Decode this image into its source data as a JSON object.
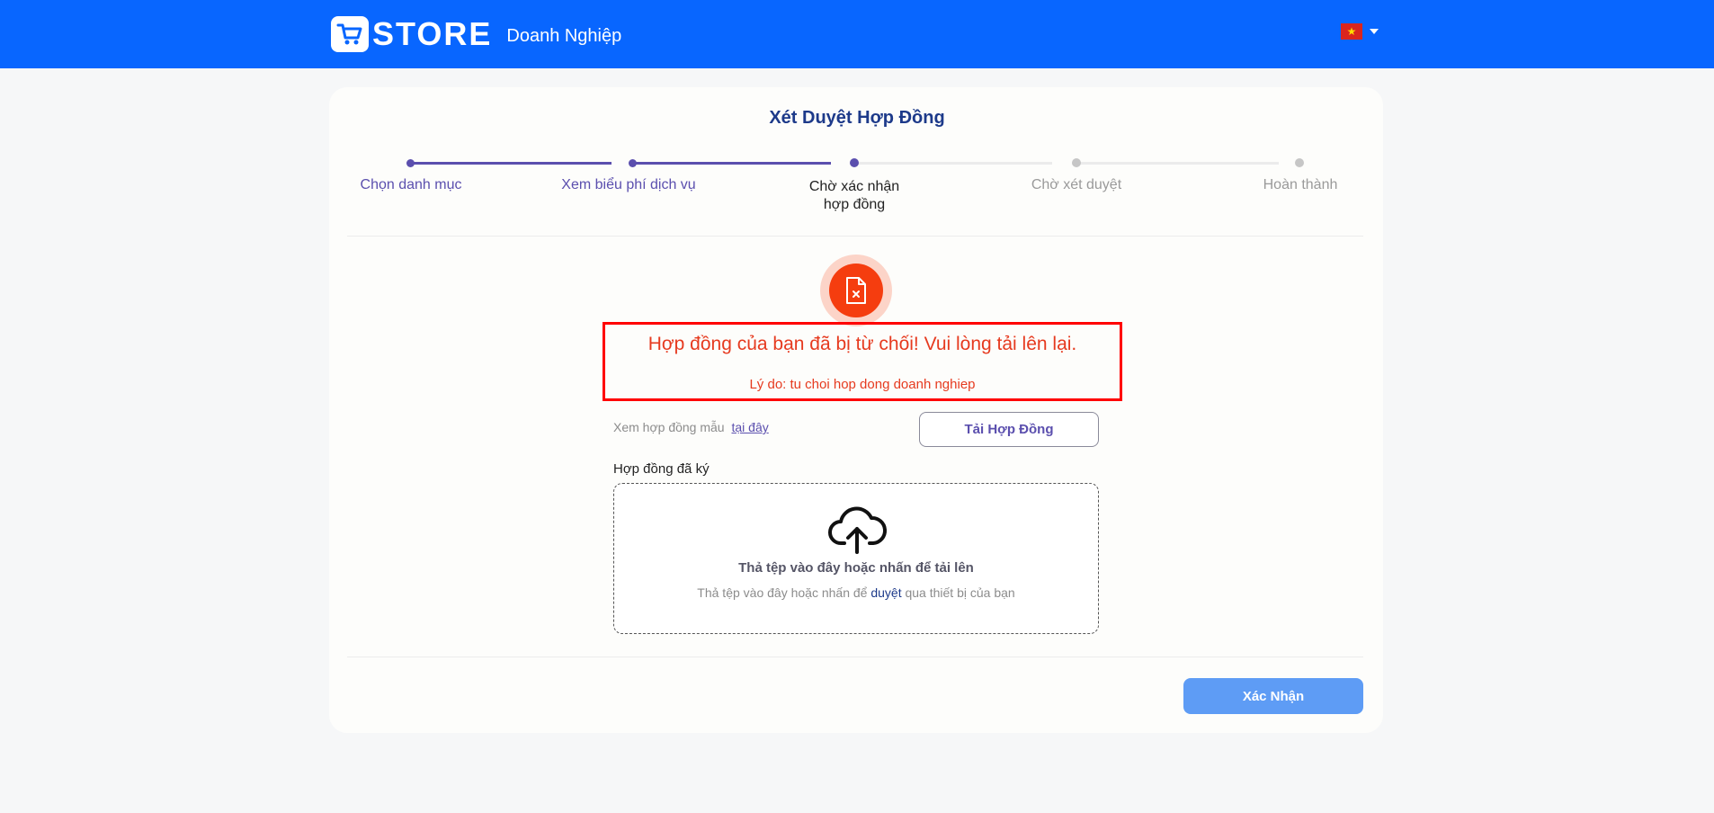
{
  "header": {
    "logo_text": "STORE",
    "logo_sub": "Doanh Nghiệp",
    "language_flag": "vn-flag-icon"
  },
  "page": {
    "title": "Xét Duyệt Hợp Đồng"
  },
  "steps": [
    {
      "label": "Chọn danh mục",
      "state": "done"
    },
    {
      "label": "Xem biểu phí dịch vụ",
      "state": "done"
    },
    {
      "label": "Chờ xác nhận hợp đồng",
      "state": "current"
    },
    {
      "label": "Chờ xét duyệt",
      "state": "pending"
    },
    {
      "label": "Hoàn thành",
      "state": "pending"
    }
  ],
  "rejection": {
    "icon": "file-rejected-icon",
    "title": "Hợp đồng của bạn đã bị từ chối! Vui lòng tải lên lại.",
    "reason": "Lý do: tu choi hop dong doanh nghiep"
  },
  "sample": {
    "text": "Xem hợp đồng mẫu",
    "link": "tại đây"
  },
  "download_button": "Tải Hợp Đồng",
  "upload": {
    "label": "Hợp đồng đã ký",
    "title": "Thả tệp vào đây hoặc nhấn để tải lên",
    "sub_before": "Thả tệp vào đây hoặc nhấn để",
    "sub_link": "duyệt",
    "sub_after": "qua thiết bị của bạn"
  },
  "confirm_button": "Xác Nhận",
  "colors": {
    "primary": "#0866ff",
    "accent": "#5b4fae",
    "error": "#e63a1f",
    "confirm": "#5e9cf5"
  }
}
